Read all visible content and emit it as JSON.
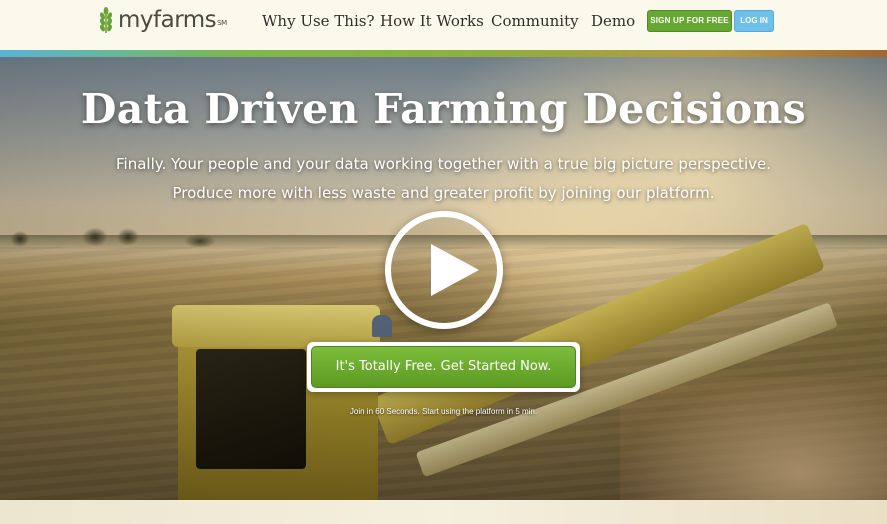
{
  "brand": {
    "name": "myfarms",
    "mark": "SM",
    "icon": "wheat-icon"
  },
  "nav": {
    "items": [
      {
        "label": "Why Use This?"
      },
      {
        "label": "How It Works"
      },
      {
        "label": "Community"
      },
      {
        "label": "Demo"
      }
    ],
    "signup_label": "SIGN UP FOR FREE",
    "login_label": "LOG IN"
  },
  "hero": {
    "headline": "Data Driven Farming Decisions",
    "subline_1": "Finally. Your people and your data working together with a true big picture perspective.",
    "subline_2": "Produce more with less waste and greater profit by joining our platform.",
    "play_icon": "play-icon",
    "cta_label": "It's Totally Free. Get Started Now.",
    "cta_note": "Join in 60 Seconds. Start using the platform in 5 min."
  },
  "colors": {
    "primary_green": "#66a832",
    "login_blue": "#6ec0e8",
    "header_bg": "#fbf8ec"
  }
}
